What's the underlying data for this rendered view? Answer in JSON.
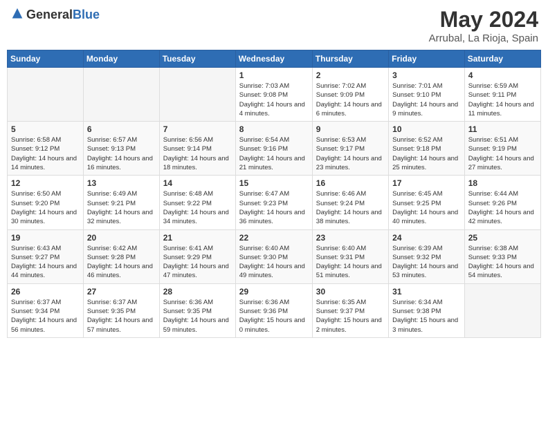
{
  "header": {
    "logo_general": "General",
    "logo_blue": "Blue",
    "month": "May 2024",
    "location": "Arrubal, La Rioja, Spain"
  },
  "weekdays": [
    "Sunday",
    "Monday",
    "Tuesday",
    "Wednesday",
    "Thursday",
    "Friday",
    "Saturday"
  ],
  "weeks": [
    [
      {
        "day": "",
        "sunrise": "",
        "sunset": "",
        "daylight": ""
      },
      {
        "day": "",
        "sunrise": "",
        "sunset": "",
        "daylight": ""
      },
      {
        "day": "",
        "sunrise": "",
        "sunset": "",
        "daylight": ""
      },
      {
        "day": "1",
        "sunrise": "Sunrise: 7:03 AM",
        "sunset": "Sunset: 9:08 PM",
        "daylight": "Daylight: 14 hours and 4 minutes."
      },
      {
        "day": "2",
        "sunrise": "Sunrise: 7:02 AM",
        "sunset": "Sunset: 9:09 PM",
        "daylight": "Daylight: 14 hours and 6 minutes."
      },
      {
        "day": "3",
        "sunrise": "Sunrise: 7:01 AM",
        "sunset": "Sunset: 9:10 PM",
        "daylight": "Daylight: 14 hours and 9 minutes."
      },
      {
        "day": "4",
        "sunrise": "Sunrise: 6:59 AM",
        "sunset": "Sunset: 9:11 PM",
        "daylight": "Daylight: 14 hours and 11 minutes."
      }
    ],
    [
      {
        "day": "5",
        "sunrise": "Sunrise: 6:58 AM",
        "sunset": "Sunset: 9:12 PM",
        "daylight": "Daylight: 14 hours and 14 minutes."
      },
      {
        "day": "6",
        "sunrise": "Sunrise: 6:57 AM",
        "sunset": "Sunset: 9:13 PM",
        "daylight": "Daylight: 14 hours and 16 minutes."
      },
      {
        "day": "7",
        "sunrise": "Sunrise: 6:56 AM",
        "sunset": "Sunset: 9:14 PM",
        "daylight": "Daylight: 14 hours and 18 minutes."
      },
      {
        "day": "8",
        "sunrise": "Sunrise: 6:54 AM",
        "sunset": "Sunset: 9:16 PM",
        "daylight": "Daylight: 14 hours and 21 minutes."
      },
      {
        "day": "9",
        "sunrise": "Sunrise: 6:53 AM",
        "sunset": "Sunset: 9:17 PM",
        "daylight": "Daylight: 14 hours and 23 minutes."
      },
      {
        "day": "10",
        "sunrise": "Sunrise: 6:52 AM",
        "sunset": "Sunset: 9:18 PM",
        "daylight": "Daylight: 14 hours and 25 minutes."
      },
      {
        "day": "11",
        "sunrise": "Sunrise: 6:51 AM",
        "sunset": "Sunset: 9:19 PM",
        "daylight": "Daylight: 14 hours and 27 minutes."
      }
    ],
    [
      {
        "day": "12",
        "sunrise": "Sunrise: 6:50 AM",
        "sunset": "Sunset: 9:20 PM",
        "daylight": "Daylight: 14 hours and 30 minutes."
      },
      {
        "day": "13",
        "sunrise": "Sunrise: 6:49 AM",
        "sunset": "Sunset: 9:21 PM",
        "daylight": "Daylight: 14 hours and 32 minutes."
      },
      {
        "day": "14",
        "sunrise": "Sunrise: 6:48 AM",
        "sunset": "Sunset: 9:22 PM",
        "daylight": "Daylight: 14 hours and 34 minutes."
      },
      {
        "day": "15",
        "sunrise": "Sunrise: 6:47 AM",
        "sunset": "Sunset: 9:23 PM",
        "daylight": "Daylight: 14 hours and 36 minutes."
      },
      {
        "day": "16",
        "sunrise": "Sunrise: 6:46 AM",
        "sunset": "Sunset: 9:24 PM",
        "daylight": "Daylight: 14 hours and 38 minutes."
      },
      {
        "day": "17",
        "sunrise": "Sunrise: 6:45 AM",
        "sunset": "Sunset: 9:25 PM",
        "daylight": "Daylight: 14 hours and 40 minutes."
      },
      {
        "day": "18",
        "sunrise": "Sunrise: 6:44 AM",
        "sunset": "Sunset: 9:26 PM",
        "daylight": "Daylight: 14 hours and 42 minutes."
      }
    ],
    [
      {
        "day": "19",
        "sunrise": "Sunrise: 6:43 AM",
        "sunset": "Sunset: 9:27 PM",
        "daylight": "Daylight: 14 hours and 44 minutes."
      },
      {
        "day": "20",
        "sunrise": "Sunrise: 6:42 AM",
        "sunset": "Sunset: 9:28 PM",
        "daylight": "Daylight: 14 hours and 46 minutes."
      },
      {
        "day": "21",
        "sunrise": "Sunrise: 6:41 AM",
        "sunset": "Sunset: 9:29 PM",
        "daylight": "Daylight: 14 hours and 47 minutes."
      },
      {
        "day": "22",
        "sunrise": "Sunrise: 6:40 AM",
        "sunset": "Sunset: 9:30 PM",
        "daylight": "Daylight: 14 hours and 49 minutes."
      },
      {
        "day": "23",
        "sunrise": "Sunrise: 6:40 AM",
        "sunset": "Sunset: 9:31 PM",
        "daylight": "Daylight: 14 hours and 51 minutes."
      },
      {
        "day": "24",
        "sunrise": "Sunrise: 6:39 AM",
        "sunset": "Sunset: 9:32 PM",
        "daylight": "Daylight: 14 hours and 53 minutes."
      },
      {
        "day": "25",
        "sunrise": "Sunrise: 6:38 AM",
        "sunset": "Sunset: 9:33 PM",
        "daylight": "Daylight: 14 hours and 54 minutes."
      }
    ],
    [
      {
        "day": "26",
        "sunrise": "Sunrise: 6:37 AM",
        "sunset": "Sunset: 9:34 PM",
        "daylight": "Daylight: 14 hours and 56 minutes."
      },
      {
        "day": "27",
        "sunrise": "Sunrise: 6:37 AM",
        "sunset": "Sunset: 9:35 PM",
        "daylight": "Daylight: 14 hours and 57 minutes."
      },
      {
        "day": "28",
        "sunrise": "Sunrise: 6:36 AM",
        "sunset": "Sunset: 9:35 PM",
        "daylight": "Daylight: 14 hours and 59 minutes."
      },
      {
        "day": "29",
        "sunrise": "Sunrise: 6:36 AM",
        "sunset": "Sunset: 9:36 PM",
        "daylight": "Daylight: 15 hours and 0 minutes."
      },
      {
        "day": "30",
        "sunrise": "Sunrise: 6:35 AM",
        "sunset": "Sunset: 9:37 PM",
        "daylight": "Daylight: 15 hours and 2 minutes."
      },
      {
        "day": "31",
        "sunrise": "Sunrise: 6:34 AM",
        "sunset": "Sunset: 9:38 PM",
        "daylight": "Daylight: 15 hours and 3 minutes."
      },
      {
        "day": "",
        "sunrise": "",
        "sunset": "",
        "daylight": ""
      }
    ]
  ]
}
